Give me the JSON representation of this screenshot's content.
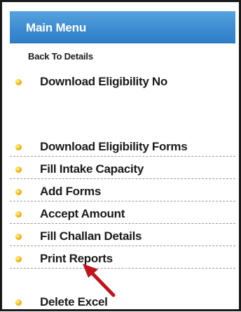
{
  "menu": {
    "title": "Main Menu",
    "back_link": "Back To Details",
    "items": [
      {
        "label": "Download Eligibility No"
      },
      {
        "label": "Download Eligibility Forms"
      },
      {
        "label": "Fill Intake Capacity"
      },
      {
        "label": "Add Forms"
      },
      {
        "label": "Accept Amount"
      },
      {
        "label": "Fill Challan Details"
      },
      {
        "label": "Print Reports"
      },
      {
        "label": "Delete Excel"
      }
    ]
  },
  "colors": {
    "header": "#3f8ed2",
    "bullet": "#f4c21a",
    "annotation_arrow": "#c0141c"
  },
  "icons": {
    "bullet": "yellow-dot-bullet-icon",
    "annotation": "red-arrow-annotation"
  }
}
